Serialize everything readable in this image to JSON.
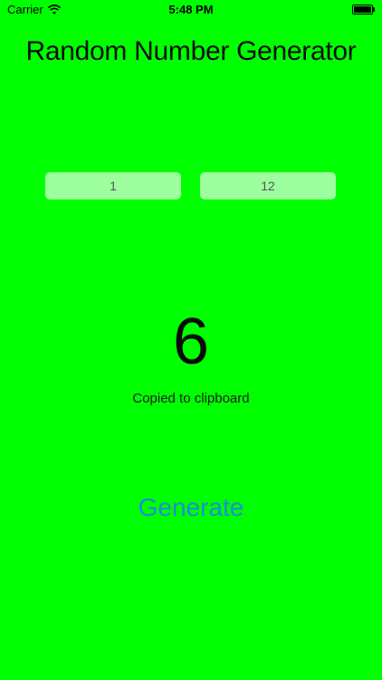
{
  "status_bar": {
    "carrier": "Carrier",
    "wifi_icon": "wifi-icon",
    "time": "5:48 PM",
    "battery_icon": "battery-icon",
    "battery_level_percent": 100
  },
  "app": {
    "title": "Random Number Generator"
  },
  "range": {
    "min_value": "1",
    "max_value": "12"
  },
  "result": {
    "number": "6",
    "status": "Copied to clipboard"
  },
  "actions": {
    "generate_label": "Generate"
  },
  "colors": {
    "background": "#00ff00",
    "accent": "#1e8bd8"
  }
}
